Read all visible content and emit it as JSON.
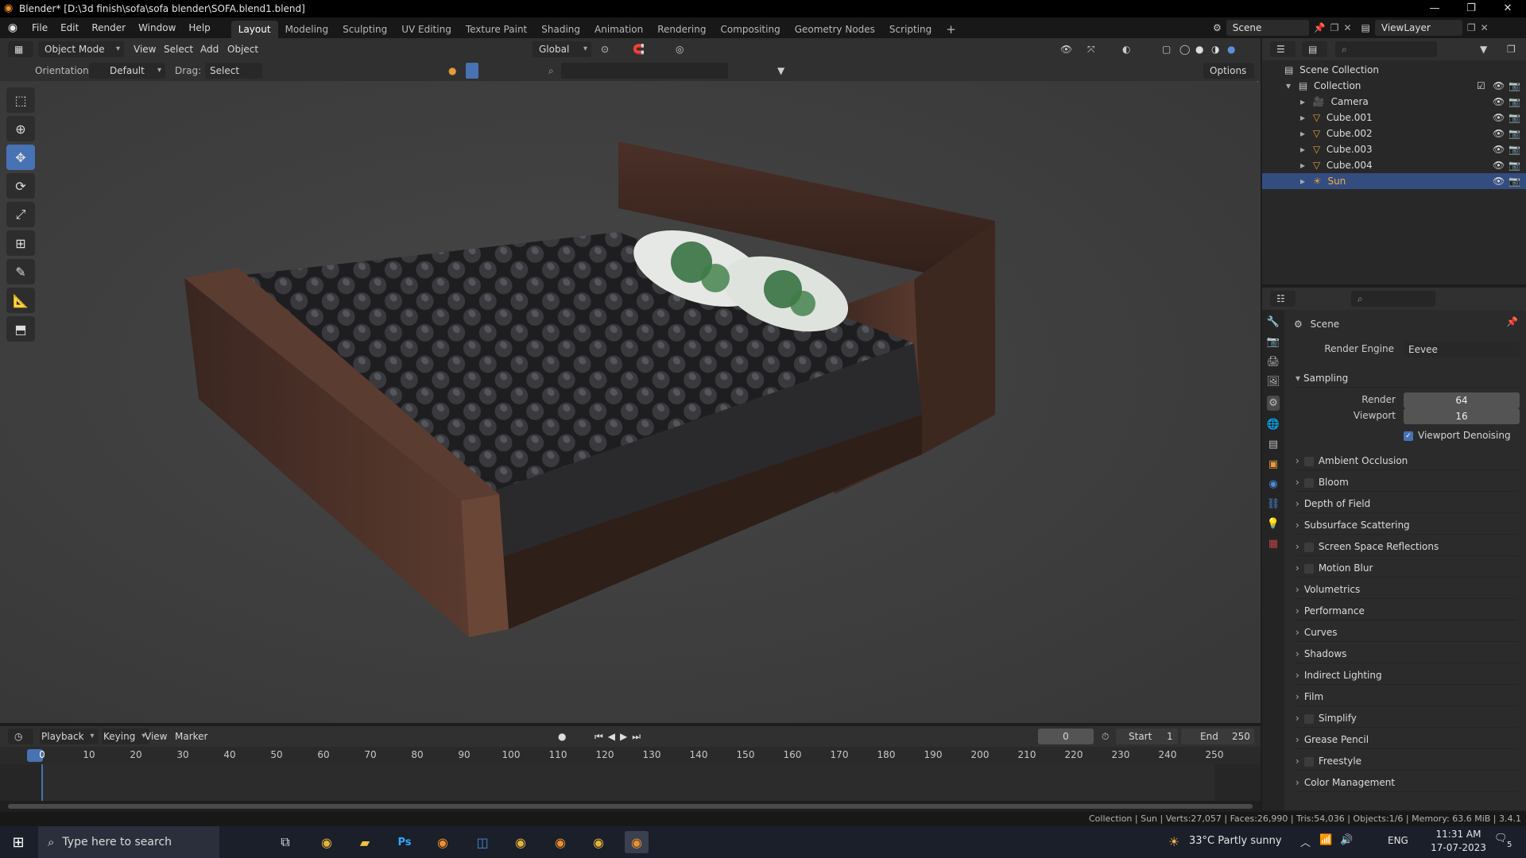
{
  "window": {
    "title": "Blender* [D:\\3d finish\\sofa\\sofa blender\\SOFA.blend1.blend]",
    "controls": [
      "—",
      "❐",
      "✕"
    ]
  },
  "menu": [
    "File",
    "Edit",
    "Render",
    "Window",
    "Help"
  ],
  "workspaces": [
    {
      "label": "Layout",
      "active": true
    },
    {
      "label": "Modeling"
    },
    {
      "label": "Sculpting"
    },
    {
      "label": "UV Editing"
    },
    {
      "label": "Texture Paint"
    },
    {
      "label": "Shading"
    },
    {
      "label": "Animation"
    },
    {
      "label": "Rendering"
    },
    {
      "label": "Compositing"
    },
    {
      "label": "Geometry Nodes"
    },
    {
      "label": "Scripting"
    }
  ],
  "scene_selector": "Scene",
  "view_layer": "ViewLayer",
  "viewport_header": {
    "mode": "Object Mode",
    "menus": [
      "View",
      "Select",
      "Add",
      "Object"
    ],
    "transform": "Global",
    "orientation_label": "Orientation:",
    "orientation_value": "Default",
    "drag_label": "Drag:",
    "drag_value": "Select Box",
    "options": "Options"
  },
  "outliner": {
    "root": "Scene Collection",
    "collection": "Collection",
    "items": [
      {
        "name": "Camera",
        "icon": "camera-icon",
        "color": "#e69a3a"
      },
      {
        "name": "Cube.001",
        "icon": "mesh-icon",
        "color": "#e69a3a"
      },
      {
        "name": "Cube.002",
        "icon": "mesh-icon",
        "color": "#e69a3a"
      },
      {
        "name": "Cube.003",
        "icon": "mesh-icon",
        "color": "#e69a3a"
      },
      {
        "name": "Cube.004",
        "icon": "mesh-icon",
        "color": "#e69a3a"
      },
      {
        "name": "Sun",
        "icon": "light-icon",
        "color": "#e69a3a",
        "selected": true
      }
    ]
  },
  "properties": {
    "context": "Scene",
    "render_engine_label": "Render Engine",
    "render_engine": "Eevee",
    "sampling": {
      "label": "Sampling",
      "render_label": "Render",
      "render_value": "64",
      "viewport_label": "Viewport",
      "viewport_value": "16",
      "denoise_label": "Viewport Denoising"
    },
    "panels": [
      {
        "label": "Ambient Occlusion",
        "checkbox": true
      },
      {
        "label": "Bloom",
        "checkbox": true
      },
      {
        "label": "Depth of Field",
        "checkbox": false
      },
      {
        "label": "Subsurface Scattering",
        "checkbox": false
      },
      {
        "label": "Screen Space Reflections",
        "checkbox": true
      },
      {
        "label": "Motion Blur",
        "checkbox": true
      },
      {
        "label": "Volumetrics",
        "checkbox": false
      },
      {
        "label": "Performance",
        "checkbox": false
      },
      {
        "label": "Curves",
        "checkbox": false
      },
      {
        "label": "Shadows",
        "checkbox": false
      },
      {
        "label": "Indirect Lighting",
        "checkbox": false
      },
      {
        "label": "Film",
        "checkbox": false
      },
      {
        "label": "Simplify",
        "checkbox": true
      },
      {
        "label": "Grease Pencil",
        "checkbox": false
      },
      {
        "label": "Freestyle",
        "checkbox": true
      },
      {
        "label": "Color Management",
        "checkbox": false
      }
    ]
  },
  "timeline": {
    "menus": [
      "Playback",
      "Keying",
      "View",
      "Marker"
    ],
    "current_frame": "0",
    "start_label": "Start",
    "start": "1",
    "end_label": "End",
    "end": "250",
    "ticks": [
      "0",
      "10",
      "20",
      "30",
      "40",
      "50",
      "60",
      "70",
      "80",
      "90",
      "100",
      "110",
      "120",
      "130",
      "140",
      "150",
      "160",
      "170",
      "180",
      "190",
      "200",
      "210",
      "220",
      "230",
      "240",
      "250"
    ]
  },
  "status_bar": "Collection | Sun | Verts:27,057 | Faces:26,990 | Tris:54,036 | Objects:1/6 | Memory: 63.6 MiB | 3.4.1",
  "taskbar": {
    "search_placeholder": "Type here to search",
    "weather": "33°C  Partly sunny",
    "language": "ENG",
    "time": "11:31 AM",
    "date": "17-07-2023",
    "notifications": "5"
  }
}
